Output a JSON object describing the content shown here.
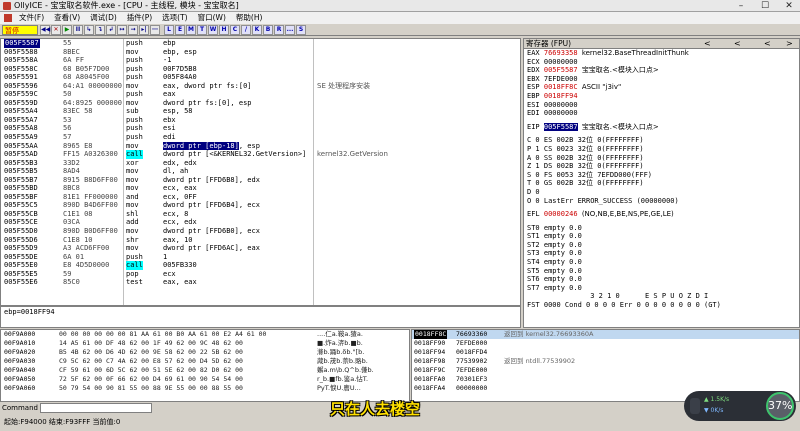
{
  "window": {
    "title": "OllyICE - 宝宝取名软件.exe - [CPU - 主线程, 模块 - 宝宝取名]",
    "min": "–",
    "max": "☐",
    "close": "✕"
  },
  "menu": [
    "文件(F)",
    "查看(V)",
    "调试(D)",
    "插件(P)",
    "选项(T)",
    "窗口(W)",
    "帮助(H)"
  ],
  "toolbar": {
    "pause_label": "暂停",
    "buttons": [
      "◀◀",
      "✕",
      "▶",
      "II",
      "↳",
      "↴",
      "↲",
      "↦",
      "→",
      "▸|",
      "⋯"
    ],
    "letters": [
      "L",
      "E",
      "M",
      "T",
      "W",
      "H",
      "C",
      "/",
      "K",
      "B",
      "R",
      "...",
      "S"
    ]
  },
  "disasm": {
    "rows": [
      {
        "addr": "005F5587",
        "hex": "55",
        "mn": "push",
        "op": "ebp",
        "cm": "",
        "sel": true
      },
      {
        "addr": "005F5588",
        "hex": "8BEC",
        "mn": "mov",
        "op": "ebp, esp",
        "cm": ""
      },
      {
        "addr": "005F558A",
        "hex": "6A FF",
        "mn": "push",
        "op": "-1",
        "cm": ""
      },
      {
        "addr": "005F558C",
        "hex": "68 B05F7D00",
        "mn": "push",
        "op": "00F7D5B8",
        "cm": ""
      },
      {
        "addr": "005F5591",
        "hex": "68 A8045F00",
        "mn": "push",
        "op": "005F84A0",
        "cm": ""
      },
      {
        "addr": "005F5596",
        "hex": "64:A1 00000000",
        "mn": "mov",
        "op": "eax, dword ptr fs:[0]",
        "cm": "SE 处理程序安装"
      },
      {
        "addr": "005F559C",
        "hex": "50",
        "mn": "push",
        "op": "eax",
        "cm": ""
      },
      {
        "addr": "005F559D",
        "hex": "64:8925 000000",
        "mn": "mov",
        "op": "dword ptr fs:[0], esp",
        "cm": ""
      },
      {
        "addr": "005F55A4",
        "hex": "83EC 58",
        "mn": "sub",
        "op": "esp, 58",
        "cm": ""
      },
      {
        "addr": "005F55A7",
        "hex": "53",
        "mn": "push",
        "op": "ebx",
        "cm": ""
      },
      {
        "addr": "005F55A8",
        "hex": "56",
        "mn": "push",
        "op": "esi",
        "cm": ""
      },
      {
        "addr": "005F55A9",
        "hex": "57",
        "mn": "push",
        "op": "edi",
        "cm": ""
      },
      {
        "addr": "005F55AA",
        "hex": "8965 E8",
        "mn": "mov",
        "op": "dword ptr [ebp-18], esp",
        "cm": "",
        "ophl": "dword ptr [ebp-18]",
        "optail": ", esp"
      },
      {
        "addr": "005F55AD",
        "hex": "FF15 A0326300",
        "mn": "call",
        "op": "dword ptr [<&KERNEL32.GetVersion>]",
        "cm": "kernel32.GetVersion",
        "call": true
      },
      {
        "addr": "005F55B3",
        "hex": "33D2",
        "mn": "xor",
        "op": "edx, edx",
        "cm": ""
      },
      {
        "addr": "005F55B5",
        "hex": "8AD4",
        "mn": "mov",
        "op": "dl, ah",
        "cm": ""
      },
      {
        "addr": "005F55B7",
        "hex": "8915 B8D6FF00",
        "mn": "mov",
        "op": "dword ptr [FFD6B8], edx",
        "cm": ""
      },
      {
        "addr": "005F55BD",
        "hex": "8BC8",
        "mn": "mov",
        "op": "ecx, eax",
        "cm": ""
      },
      {
        "addr": "005F55BF",
        "hex": "81E1 FF000000",
        "mn": "and",
        "op": "ecx, 0FF",
        "cm": ""
      },
      {
        "addr": "005F55C5",
        "hex": "890D B4D6FF00",
        "mn": "mov",
        "op": "dword ptr [FFD6B4], ecx",
        "cm": ""
      },
      {
        "addr": "005F55CB",
        "hex": "C1E1 08",
        "mn": "shl",
        "op": "ecx, 8",
        "cm": ""
      },
      {
        "addr": "005F55CE",
        "hex": "03CA",
        "mn": "add",
        "op": "ecx, edx",
        "cm": ""
      },
      {
        "addr": "005F55D0",
        "hex": "890D B0D6FF00",
        "mn": "mov",
        "op": "dword ptr [FFD6B0], ecx",
        "cm": ""
      },
      {
        "addr": "005F55D6",
        "hex": "C1E8 10",
        "mn": "shr",
        "op": "eax, 10",
        "cm": ""
      },
      {
        "addr": "005F55D9",
        "hex": "A3 ACD6FF00",
        "mn": "mov",
        "op": "dword ptr [FFD6AC], eax",
        "cm": ""
      },
      {
        "addr": "005F55DE",
        "hex": "6A 01",
        "mn": "push",
        "op": "1",
        "cm": ""
      },
      {
        "addr": "005F55E0",
        "hex": "E8 4D5D0000",
        "mn": "call",
        "op": "005FB330",
        "cm": "",
        "call": true
      },
      {
        "addr": "005F55E5",
        "hex": "59",
        "mn": "pop",
        "op": "ecx",
        "cm": ""
      },
      {
        "addr": "005F55E6",
        "hex": "85C0",
        "mn": "test",
        "op": "eax, eax",
        "cm": ""
      }
    ]
  },
  "info_line": "ebp=0018FF94",
  "registers": {
    "header": "寄存器 (FPU)",
    "rows": [
      {
        "name": "EAX",
        "val": "76693358",
        "desc": "kernel32.BaseThreadInitThunk",
        "red": true
      },
      {
        "name": "ECX",
        "val": "00000000",
        "desc": ""
      },
      {
        "name": "EDX",
        "val": "005F5587",
        "desc": "宝宝取名.<模块入口点>",
        "red": true
      },
      {
        "name": "EBX",
        "val": "7EFDE000",
        "desc": ""
      },
      {
        "name": "ESP",
        "val": "0018FF8C",
        "desc": "ASCII \"j3iv\"",
        "red": true
      },
      {
        "name": "EBP",
        "val": "0018FF94",
        "desc": "",
        "red": true
      },
      {
        "name": "ESI",
        "val": "00000000",
        "desc": ""
      },
      {
        "name": "EDI",
        "val": "00000000",
        "desc": ""
      }
    ],
    "eip": {
      "name": "EIP",
      "val": "005F5587",
      "desc": "宝宝取名.<模块入口点>"
    },
    "flags": [
      "C 0  ES 002B 32位 0(FFFFFFFF)",
      "P 1  CS 0023 32位 0(FFFFFFFF)",
      "A 0  SS 002B 32位 0(FFFFFFFF)",
      "Z 1  DS 002B 32位 0(FFFFFFFF)",
      "S 0  FS 0053 32位 7EFDD000(FFF)",
      "T 0  GS 002B 32位 0(FFFFFFFF)",
      "D 0",
      "O 0  LastErr ERROR_SUCCESS (00000000)"
    ],
    "efl": {
      "name": "EFL",
      "val": "00000246",
      "desc": "(NO,NB,E,BE,NS,PE,GE,LE)"
    },
    "fpu": [
      "ST0 empty 0.0",
      "ST1 empty 0.0",
      "ST2 empty 0.0",
      "ST3 empty 0.0",
      "ST4 empty 0.0",
      "ST5 empty 0.0",
      "ST6 empty 0.0",
      "ST7 empty 0.0"
    ],
    "fpu_bits": "               3 2 1 0      E S P U O Z D I",
    "fst": "FST 0000  Cond 0 0 0 0  Err 0 0 0 0 0 0 0 0  (GT)"
  },
  "dump": {
    "rows": [
      {
        "a": "00F9A000",
        "h": "00 00 00 00 00 00 81 AA 61 00 B0 AA 61 00 E2 A4 61 00",
        "s": "....仁a.鞍a.猹a."
      },
      {
        "a": "00F9A010",
        "h": "14 A5 61 00 DF 48 62 00 1F 49 62 00 9C 48 62 00",
        "s": "■.炸a.渀b.■b."
      },
      {
        "a": "00F9A020",
        "h": "B5 4B 62 00 D6 4D 62 00 9E 58 62 00 22 5B 62 00",
        "s": "滌b.踊b.ὄb.\"[b."
      },
      {
        "a": "00F9A030",
        "h": "C9 5C 62 00 C7 4A 62 00 E8 57 62 00 D4 5D 62 00",
        "s": "蒧b.荗b.萗b.賂b."
      },
      {
        "a": "00F9A040",
        "h": "CF 59 61 00 6D 5C 62 00 51 5E 62 00 82 D0 62 00",
        "s": "蠏a.m\\b.Q^b.傔b."
      },
      {
        "a": "00F9A050",
        "h": "72 5F 62 00 0F 66 62 00 D4 69 61 00 90 54 54 00",
        "s": "r_b.■fb.鉴a.怗T."
      },
      {
        "a": "00F9A060",
        "h": "50 79 54 00 90 81 55 00 88 9E 55 00 00 88 55 00",
        "s": "PyT.悷U.噟U..."
      }
    ]
  },
  "stack": {
    "rows": [
      {
        "a": "0018FF8C",
        "v": "76693360",
        "c": "返回到 kernel32.76693360A",
        "sel": true
      },
      {
        "a": "0018FF90",
        "v": "7EFDE000",
        "c": ""
      },
      {
        "a": "0018FF94",
        "v": "0018FFD4",
        "c": ""
      },
      {
        "a": "0018FF98",
        "v": "77539902",
        "c": "返回到 ntdll.77539902"
      },
      {
        "a": "0018FF9C",
        "v": "7EFDE000",
        "c": ""
      },
      {
        "a": "0018FFA0",
        "v": "70301EF3",
        "c": ""
      },
      {
        "a": "0018FFA4",
        "v": "00000000",
        "c": ""
      }
    ]
  },
  "command": {
    "label": "Command"
  },
  "status": "起始:F94000 结束:F93FFF 当前值:0",
  "subtitle": "只在人去楼空",
  "net": {
    "up": "▲ 1.5K/s",
    "down": "▼ 0K/s",
    "pct": "37%"
  }
}
